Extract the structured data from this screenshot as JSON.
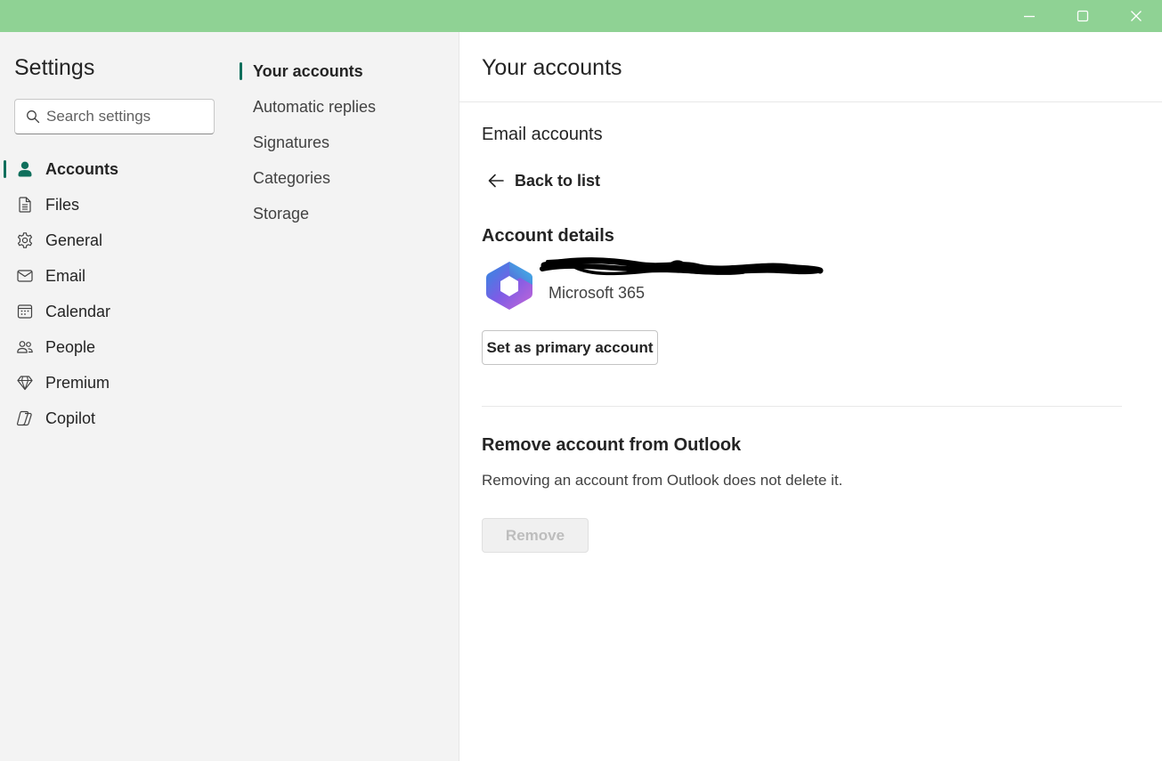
{
  "titlebar": {
    "background": "#8fd294",
    "buttons": [
      "minimize-icon",
      "maximize-icon",
      "close-icon"
    ]
  },
  "nav": {
    "title": "Settings",
    "search_placeholder": "Search settings",
    "accent": "#0f6f5c",
    "items": [
      {
        "label": "Accounts",
        "icon": "person-icon",
        "active": true
      },
      {
        "label": "Files",
        "icon": "file-icon"
      },
      {
        "label": "General",
        "icon": "gear-icon"
      },
      {
        "label": "Email",
        "icon": "mail-icon"
      },
      {
        "label": "Calendar",
        "icon": "calendar-icon"
      },
      {
        "label": "People",
        "icon": "people-icon"
      },
      {
        "label": "Premium",
        "icon": "diamond-icon"
      },
      {
        "label": "Copilot",
        "icon": "copilot-icon"
      }
    ]
  },
  "subnav": {
    "items": [
      {
        "label": "Your accounts",
        "active": true
      },
      {
        "label": "Automatic replies"
      },
      {
        "label": "Signatures"
      },
      {
        "label": "Categories"
      },
      {
        "label": "Storage"
      }
    ]
  },
  "main": {
    "title": "Your accounts",
    "email_accounts_heading": "Email accounts",
    "back_label": "Back to list",
    "account_details_heading": "Account details",
    "account": {
      "logo": "microsoft-365-logo",
      "type": "Microsoft 365"
    },
    "set_primary_label": "Set as primary account",
    "remove_heading": "Remove account from Outlook",
    "remove_description": "Removing an account from Outlook does not delete it.",
    "remove_label": "Remove"
  }
}
